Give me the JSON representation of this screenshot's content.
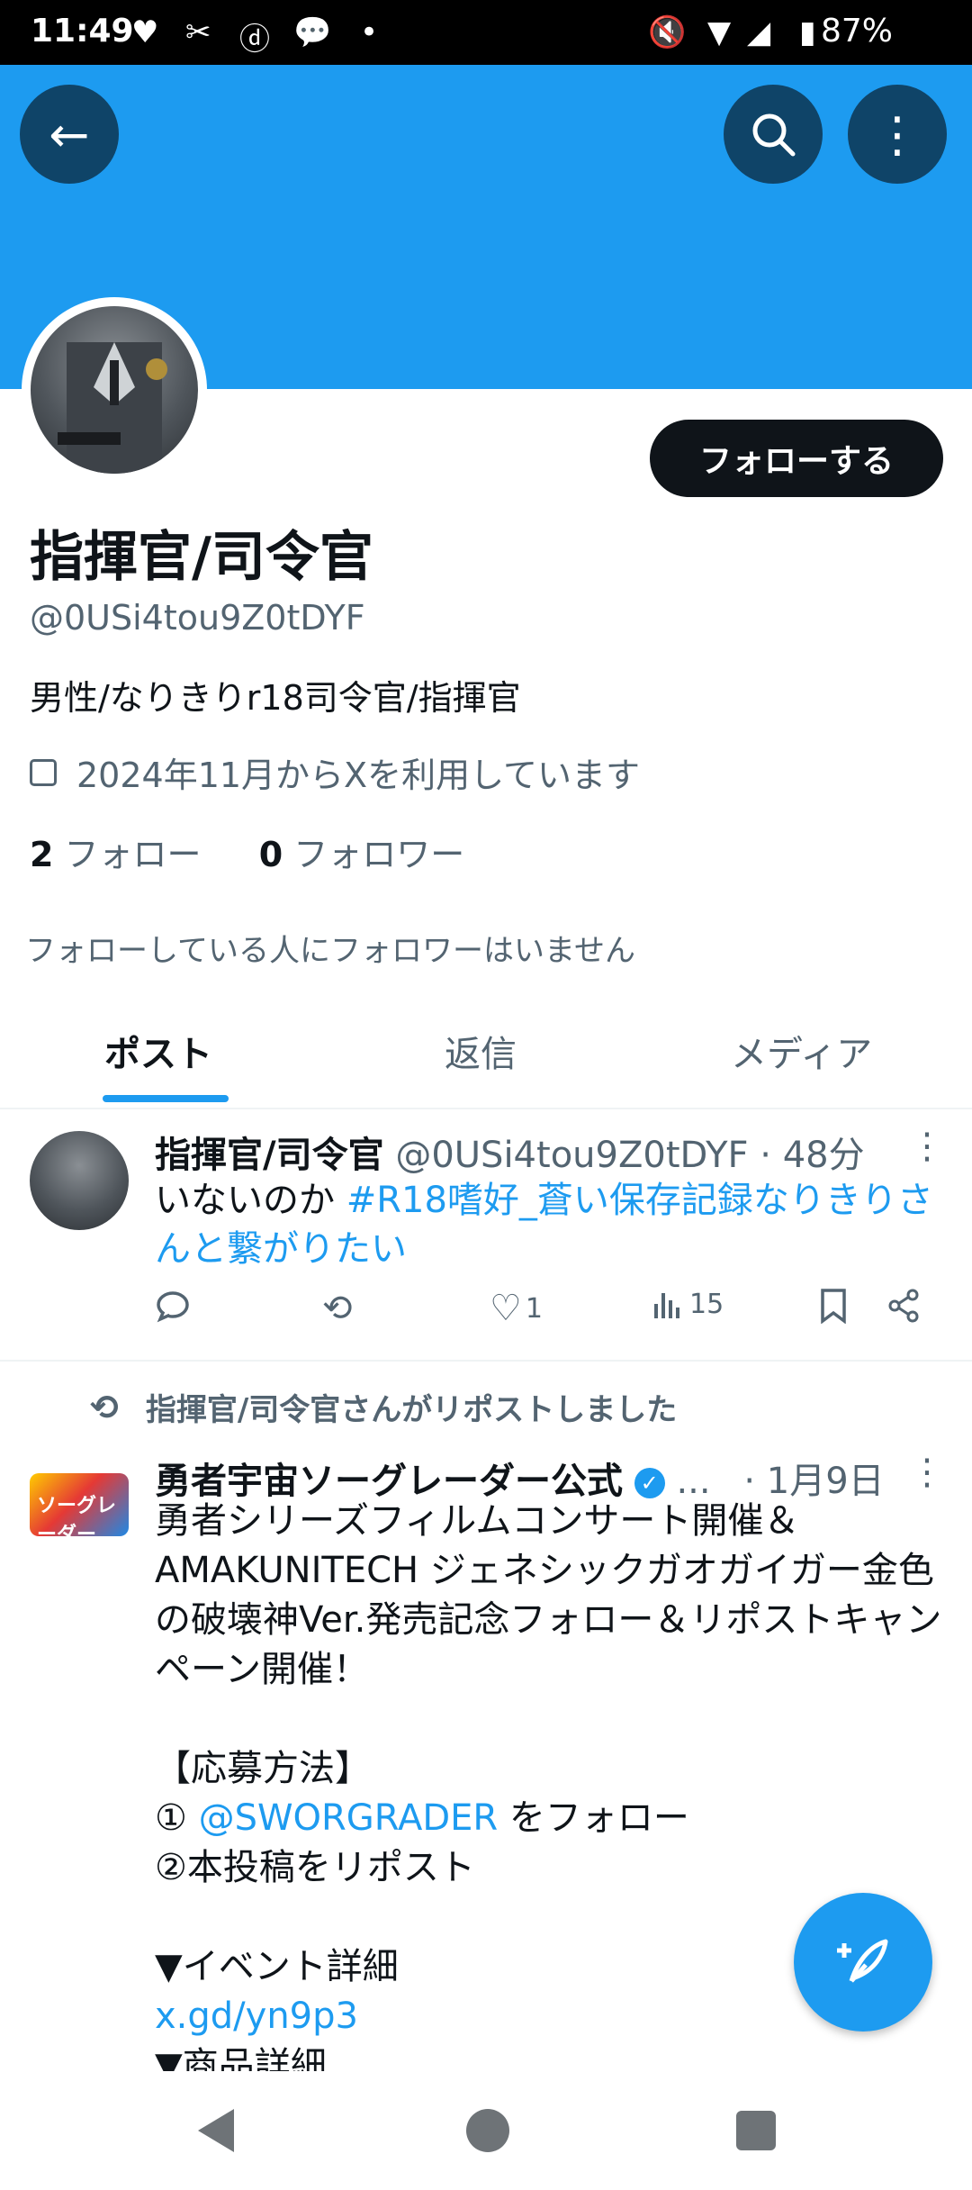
{
  "status_bar": {
    "time": "11:49",
    "left_icons": [
      "heart-icon",
      "missed-call-icon",
      "d-icon",
      "band-icon",
      "dot-icon"
    ],
    "battery": "87%",
    "right_icons": [
      "mute-icon",
      "wifi-icon",
      "signal-icon",
      "battery-icon"
    ]
  },
  "header": {
    "back_icon": "←",
    "search_icon": "⌕",
    "menu_icon": "⋮"
  },
  "profile": {
    "follow_button": "フォローする",
    "name": "指揮官/司令官",
    "handle": "@0USi4tou9Z0tDYF",
    "bio": "男性/なりきりr18司令官/指揮官",
    "joined": "2024年11月からXを利用しています",
    "following_count": "2",
    "following_label": "フォロー",
    "followers_count": "0",
    "followers_label": "フォロワー",
    "no_followers_note": "フォローしている人にフォロワーはいません"
  },
  "tabs": [
    {
      "label": "ポスト",
      "active": true
    },
    {
      "label": "返信",
      "active": false
    },
    {
      "label": "メディア",
      "active": false
    }
  ],
  "post1": {
    "name": "指揮官/司令官",
    "handle_time": "@0USi4tou9Z0tDYF · 48分",
    "text_plain": "いないのか ",
    "text_link": "#R18嗜好_蒼い保存記録なりきりさんと繋がりたい",
    "views": "15",
    "likes": "1"
  },
  "post2": {
    "repost_note": "指揮官/司令官さんがリポストしました",
    "name": "勇者宇宙ソーグレーダー公式",
    "ellipsis": "...",
    "time": "· 1月9日",
    "logo_text": "ソーグレーダー",
    "text_main": "勇者シリーズフィルムコンサート開催＆AMAKUNITECH ジェネシックガオガイガー金色の破壊神Ver.発売記念フォロー＆リポストキャンペーン開催！",
    "section_title": "【応募方法】",
    "step1_prefix": "① ",
    "step1_link": "@SWORGRADER",
    "step1_suffix": " をフォロー",
    "step2": "②本投稿をリポスト",
    "event_label": "▼イベント詳細",
    "event_link": "x.gd/yn9p3",
    "product_label": "▼商品詳細"
  },
  "fab_icon": "compose-icon"
}
